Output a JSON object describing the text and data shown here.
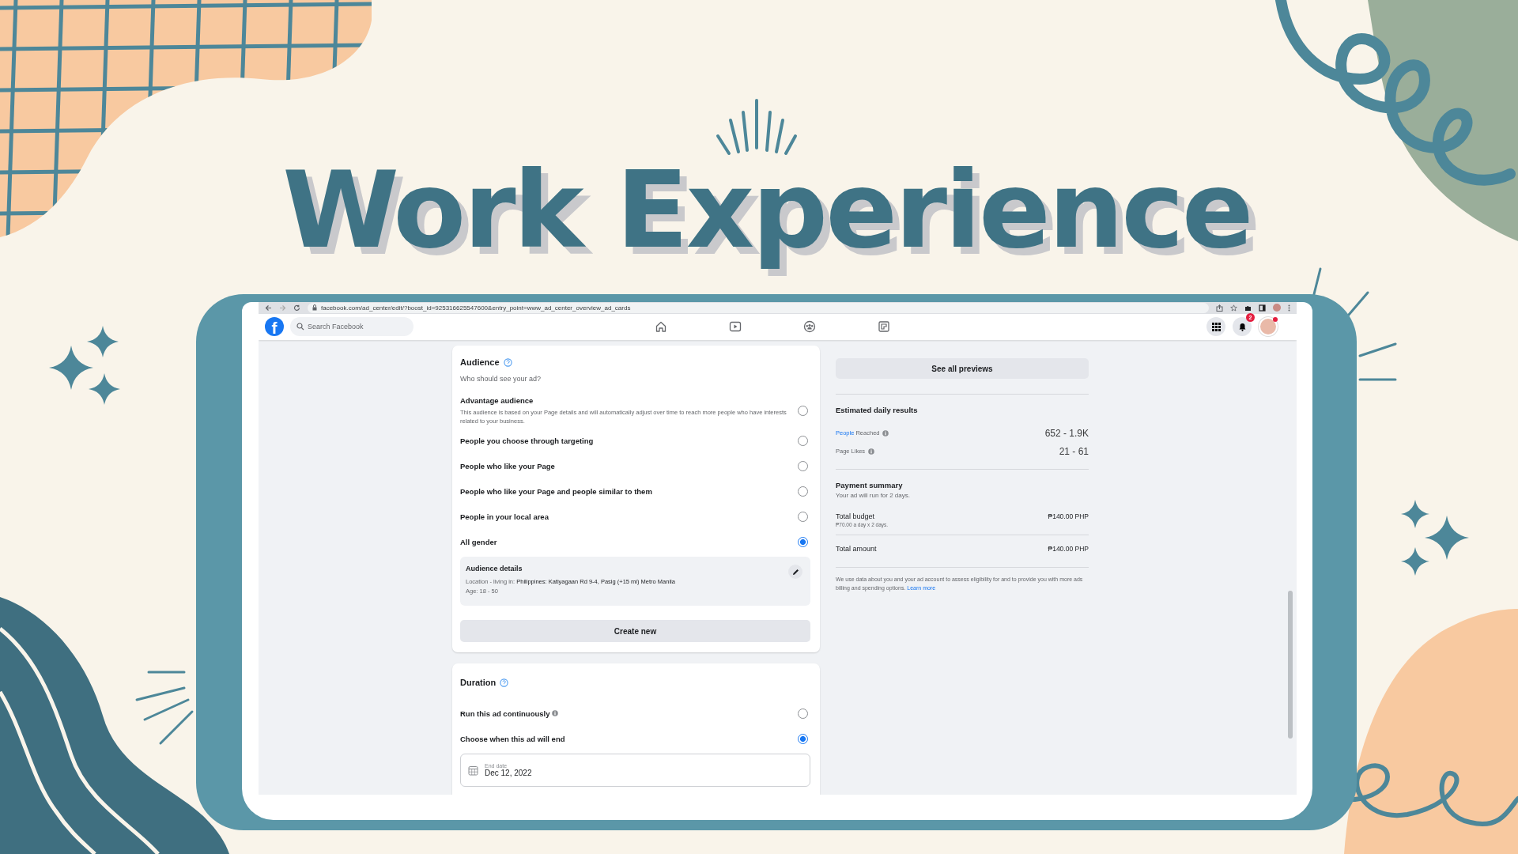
{
  "slide_title": "Work Experience",
  "browser": {
    "url": "facebook.com/ad_center/edit/?boost_id=925316625547600&entry_point=www_ad_center_overview_ad_cards"
  },
  "navbar": {
    "logo_letter": "f",
    "search_placeholder": "Search Facebook",
    "notification_badge": "2"
  },
  "audience": {
    "title": "Audience",
    "subtitle": "Who should see your ad?",
    "options": [
      {
        "label": "Advantage audience",
        "description": "This audience is based on your Page details and will automatically adjust over time to reach more people who have interests related to your business.",
        "selected": false
      },
      {
        "label": "People you choose through targeting",
        "selected": false
      },
      {
        "label": "People who like your Page",
        "selected": false
      },
      {
        "label": "People who like your Page and people similar to them",
        "selected": false
      },
      {
        "label": "People in your local area",
        "selected": false
      },
      {
        "label": "All gender",
        "selected": true
      }
    ],
    "details": {
      "title": "Audience details",
      "location_label": "Location - living in:",
      "location": "Philippines: Katiyagaan Rd 9-4, Pasig (+15 mi) Metro Manila",
      "age": "Age: 18 - 50"
    },
    "create_button": "Create new"
  },
  "duration": {
    "title": "Duration",
    "options": [
      {
        "label": "Run this ad continuously",
        "info": true,
        "selected": false
      },
      {
        "label": "Choose when this ad will end",
        "info": false,
        "selected": true
      }
    ],
    "end_date": {
      "label": "End date",
      "value": "Dec 12, 2022"
    }
  },
  "summary": {
    "previews_button": "See all previews",
    "estimated_title": "Estimated daily results",
    "results": [
      {
        "link": "People",
        "label": "Reached",
        "value": "652 - 1.9K"
      },
      {
        "label": "Page Likes",
        "value": "21 - 61"
      }
    ],
    "payment_title": "Payment summary",
    "payment_note": "Your ad will run for 2 days.",
    "lines": [
      {
        "label": "Total budget",
        "sub": "₱70.00 a day x 2 days.",
        "value": "₱140.00 PHP"
      },
      {
        "label": "Total amount",
        "value": "₱140.00 PHP"
      }
    ],
    "disclaimer": "We use data about you and your ad account to assess eligibility for and to provide you with more ads billing and spending options.",
    "learn_more": "Learn more"
  }
}
